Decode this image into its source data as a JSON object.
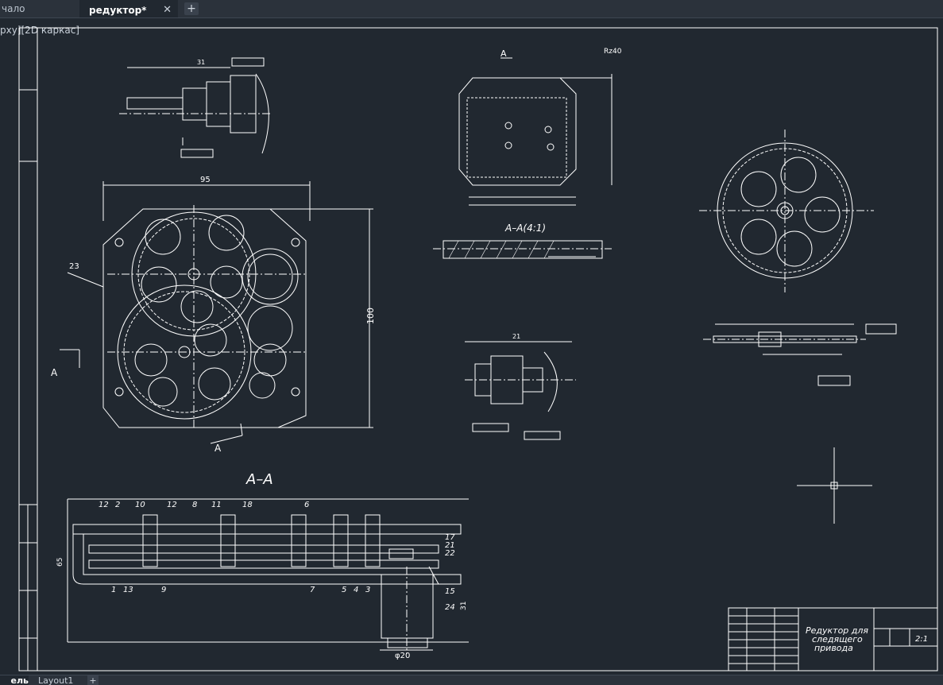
{
  "tabs": {
    "start_label": "чало",
    "active_label": "редуктор*",
    "close_glyph": "✕",
    "new_tab_glyph": "+"
  },
  "viewport": {
    "label": "рху][2D каркас]"
  },
  "layouts": {
    "model_label": "ель",
    "layout1_label": "Layout1",
    "add_glyph": "+"
  },
  "drawing": {
    "section_title": "A–A",
    "section_scaled": "A–A(4:1)",
    "label_a": "A",
    "dim_95": "95",
    "dim_100": "100",
    "dim_23": "23",
    "dim_31": "31",
    "dim_21": "21",
    "dim_65": "65",
    "dim_phi20": "φ20",
    "dim_31v": "31",
    "surface_mark": "Rz40",
    "leaders": [
      "12",
      "2",
      "10",
      "12",
      "8",
      "11",
      "18",
      "6",
      "17",
      "21",
      "22",
      "15",
      "24",
      "1",
      "13",
      "9",
      "7",
      "5",
      "4",
      "3"
    ],
    "title_block": {
      "name_line1": "Редуктор для",
      "name_line2": "следящего",
      "name_line3": "привода",
      "scale": "2:1"
    }
  },
  "colors": {
    "background": "#212830",
    "lines": "#ffffff",
    "tabbar": "#2b323b"
  }
}
